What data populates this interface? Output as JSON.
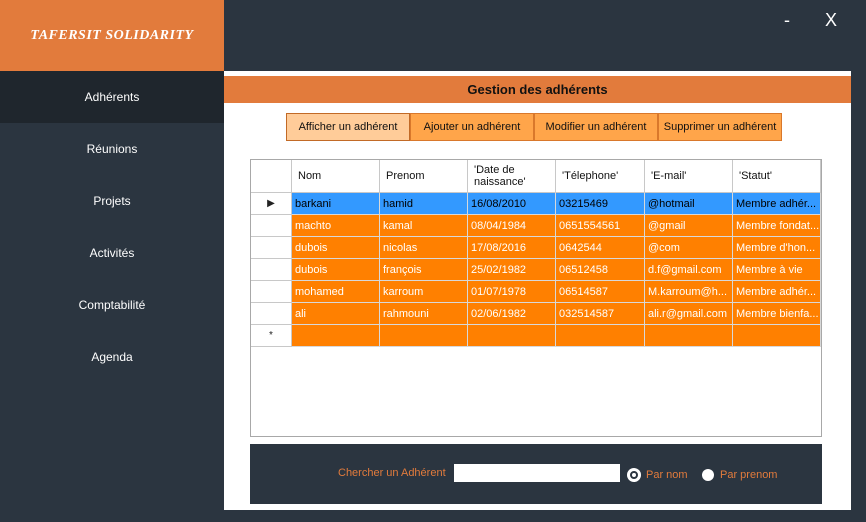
{
  "app": {
    "title": "TAFERSIT SOLIDARITY"
  },
  "window": {
    "minimize": "-",
    "close": "X"
  },
  "sidebar": {
    "items": [
      {
        "label": "Adhérents",
        "active": true
      },
      {
        "label": "Réunions",
        "active": false
      },
      {
        "label": "Projets",
        "active": false
      },
      {
        "label": "Activités",
        "active": false
      },
      {
        "label": "Comptabilité",
        "active": false
      },
      {
        "label": "Agenda",
        "active": false
      }
    ]
  },
  "main": {
    "title": "Gestion des adhérents",
    "buttons": [
      {
        "label": "Afficher un adhérent"
      },
      {
        "label": "Ajouter un adhérent"
      },
      {
        "label": "Modifier un adhérent"
      },
      {
        "label": "Supprimer un adhérent"
      }
    ]
  },
  "grid": {
    "columns": [
      "Nom",
      "Prenom",
      "'Date de naissance'",
      "'Télephone'",
      "'E-mail'",
      "'Statut'"
    ],
    "rows": [
      [
        "barkani",
        "hamid",
        "16/08/2010",
        "03215469",
        "@hotmail",
        "Membre adhér..."
      ],
      [
        "machto",
        "kamal",
        "08/04/1984",
        "0651554561",
        "@gmail",
        "Membre fondat..."
      ],
      [
        "dubois",
        "nicolas",
        "17/08/2016",
        "0642544",
        "@com",
        "Membre d'hon..."
      ],
      [
        "dubois",
        "françois",
        "25/02/1982",
        "06512458",
        "d.f@gmail.com",
        "Membre à vie"
      ],
      [
        "mohamed",
        "karroum",
        "01/07/1978",
        "06514587",
        "M.karroum@h...",
        "Membre adhér..."
      ],
      [
        "ali",
        "rahmouni",
        "02/06/1982",
        "032514587",
        "ali.r@gmail.com",
        "Membre bienfa..."
      ]
    ],
    "selected_row_marker": "▶",
    "new_row_marker": "*"
  },
  "search": {
    "label": "Chercher un Adhérent",
    "value": "",
    "options": [
      {
        "label": "Par nom",
        "checked": true
      },
      {
        "label": "Par prenom",
        "checked": false
      }
    ]
  },
  "colors": {
    "accent": "#e27b3c",
    "row": "#ff8000",
    "selected": "#3399ff",
    "dark": "#2b3540"
  }
}
